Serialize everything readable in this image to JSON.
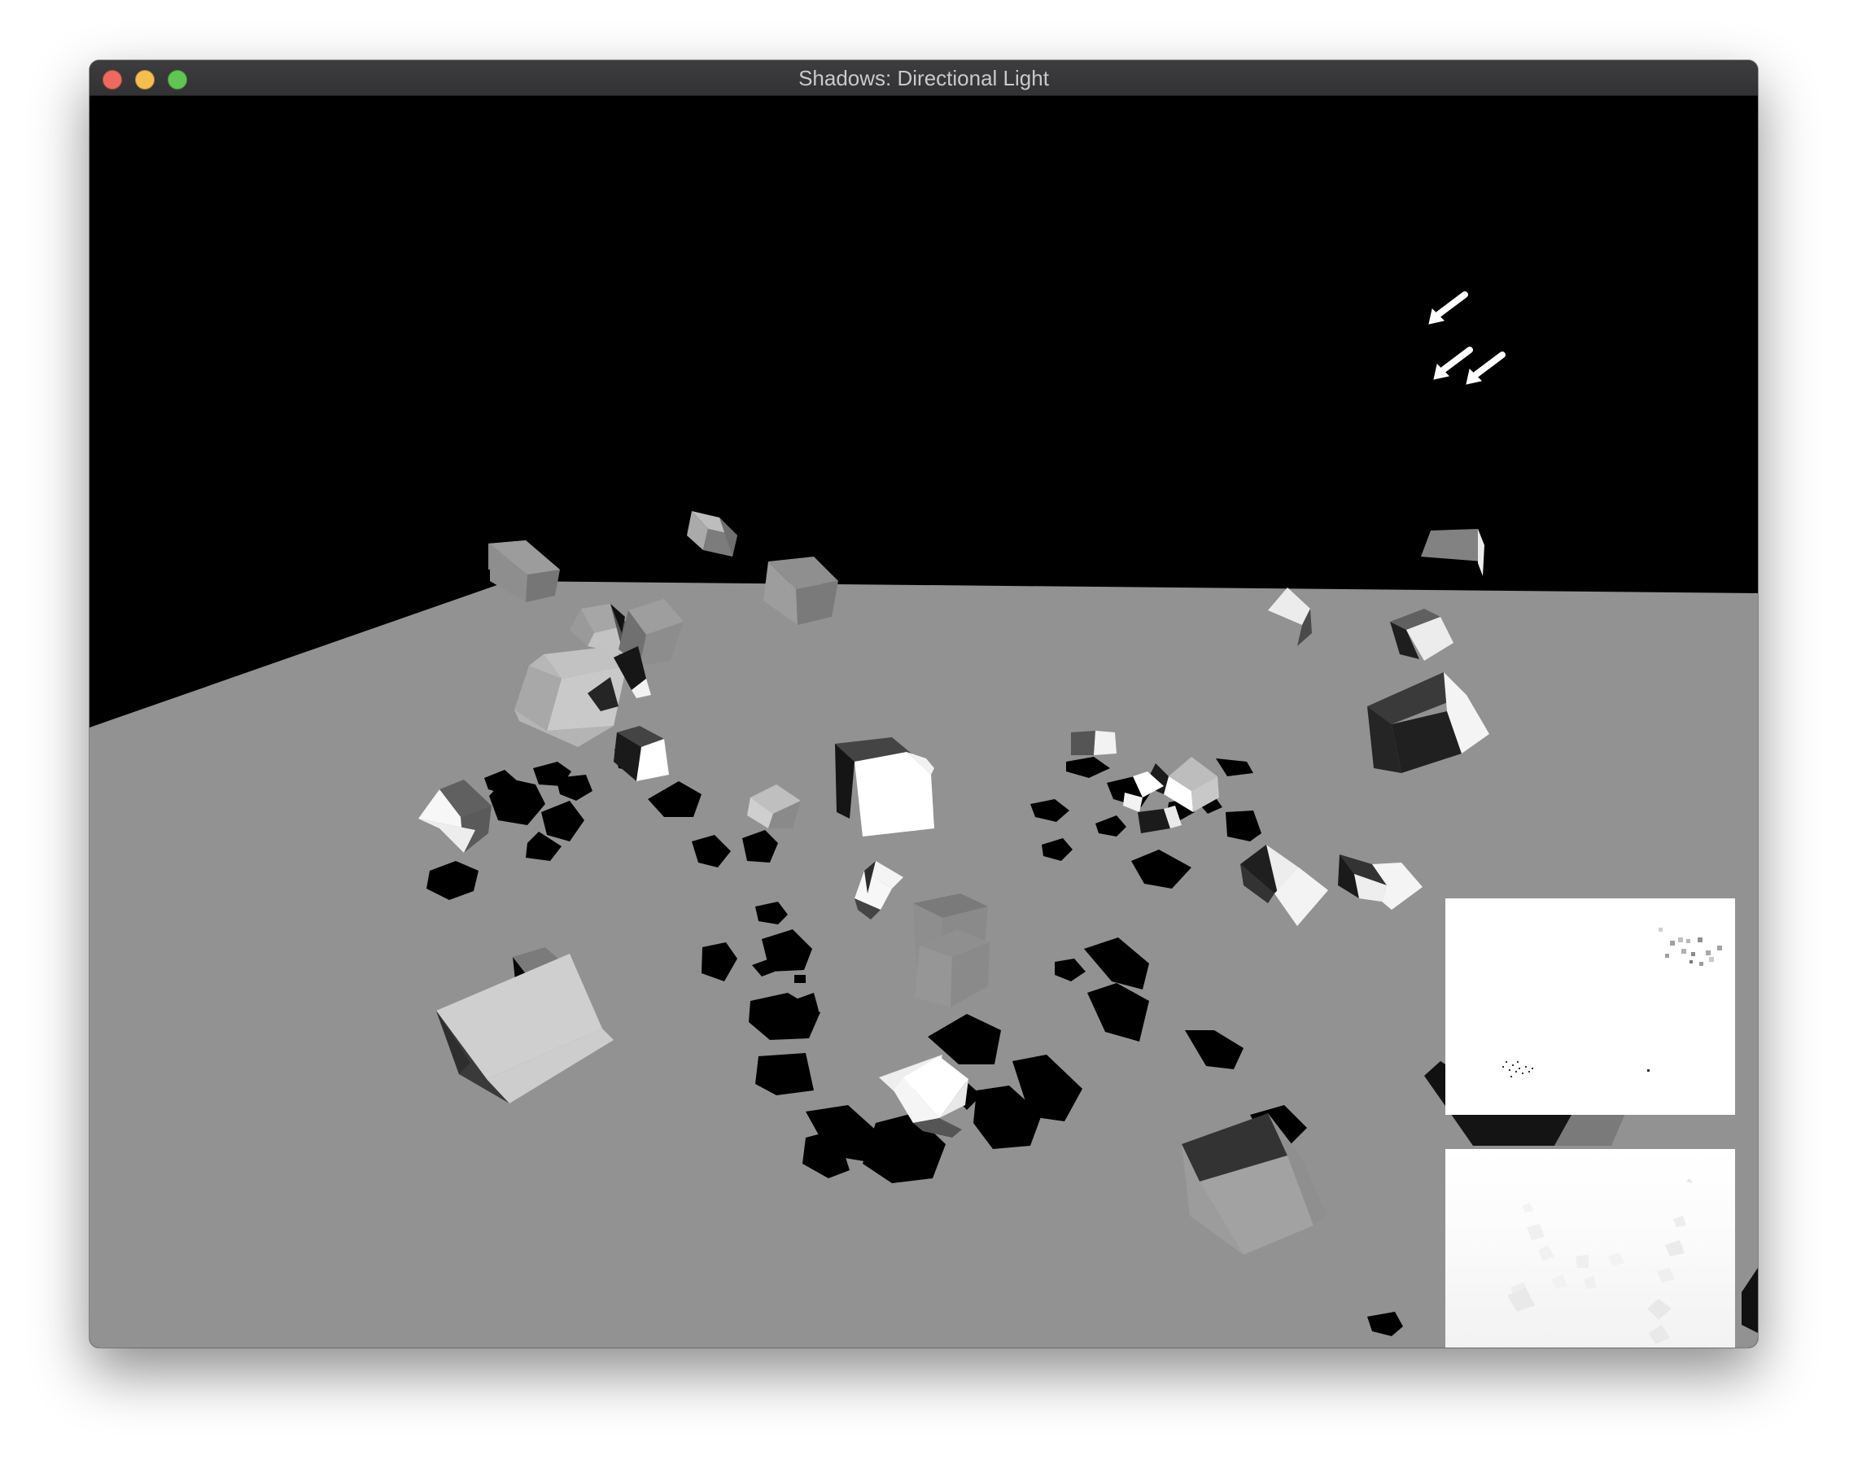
{
  "window": {
    "title": "Shadows: Directional Light",
    "buttons": {
      "close_color": "#ed6a5e",
      "minimize_color": "#f5bf4f",
      "maximize_color": "#61c554"
    }
  },
  "scene": {
    "sky_color": "#000000",
    "floor_color": "#929292",
    "shadow_color": "#000000",
    "light_indicator": "directional-light-arrows",
    "arrow_count": 3
  },
  "debug_views": [
    {
      "name": "shadow-map-view",
      "background": "#ffffff"
    },
    {
      "name": "depth-buffer-view",
      "background": "#f4f4f4"
    }
  ]
}
